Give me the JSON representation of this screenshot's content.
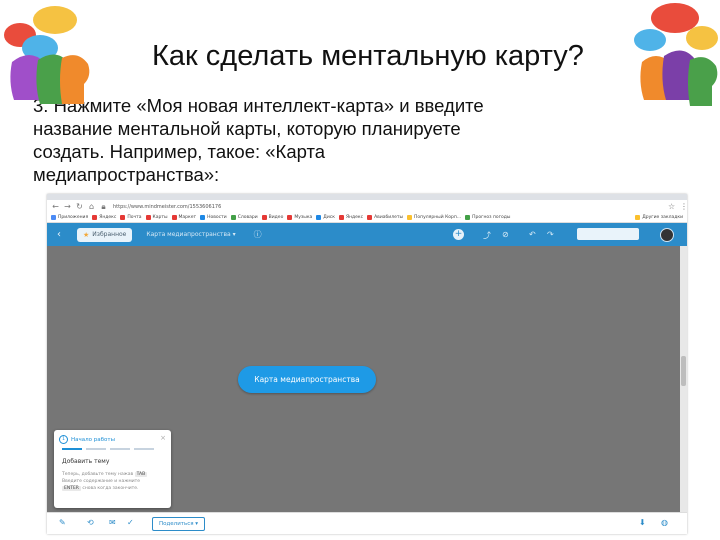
{
  "slide": {
    "title": "Как сделать ментальную карту?",
    "text": "3. Нажмите «Моя новая интеллект-карта» и введите название ментальной карты, которую планируете создать. Например, такое: «Карта медиапространства»:"
  },
  "colors": {
    "app_bar": "#2c8cc9",
    "canvas": "#767676",
    "node": "#1e9ae6"
  },
  "browser": {
    "url": "https://www.mindmeister.com/1553606176",
    "nav_icons": [
      "back-arrow-icon",
      "forward-arrow-icon",
      "reload-icon",
      "home-icon",
      "lock-icon"
    ],
    "bookmarks": [
      {
        "label": "Приложения",
        "color": "#4c8bf5"
      },
      {
        "label": "Яндекс",
        "color": "#e53935"
      },
      {
        "label": "Почта",
        "color": "#e53935"
      },
      {
        "label": "Карты",
        "color": "#e53935"
      },
      {
        "label": "Маркет",
        "color": "#e53935"
      },
      {
        "label": "Новости",
        "color": "#1e88e5"
      },
      {
        "label": "Словари",
        "color": "#43a047"
      },
      {
        "label": "Видео",
        "color": "#e53935"
      },
      {
        "label": "Музыка",
        "color": "#e53935"
      },
      {
        "label": "Диск",
        "color": "#1e88e5"
      },
      {
        "label": "Яндекс",
        "color": "#e53935"
      },
      {
        "label": "Авиабилеты",
        "color": "#e53935"
      },
      {
        "label": "Популярный Корп...",
        "color": "#fbc02d"
      },
      {
        "label": "Прогноз погоды",
        "color": "#43a047"
      }
    ],
    "other_bookmarks": "Другие закладки"
  },
  "app": {
    "back_icon": "back-chevron-icon",
    "favorites_label": "Избранное",
    "map_name": "Карта медиапространства",
    "node_label": "Карта медиапространства"
  },
  "tutorial": {
    "step_number": "1",
    "heading": "Начало работы",
    "title": "Добавить тему",
    "line1": "Теперь, добавьте тему нажав",
    "key1": "TAB",
    "line2": "Введите содержание и нажмите",
    "key2": "ENTER",
    "line3": "снова когда закончите."
  },
  "bottom": {
    "share_label": "Поделиться"
  }
}
